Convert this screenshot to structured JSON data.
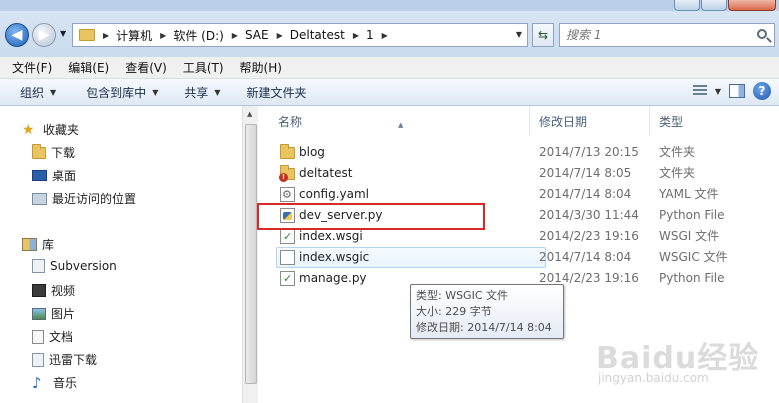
{
  "address": {
    "crumbs": [
      "计算机",
      "软件 (D:)",
      "SAE",
      "Deltatest",
      "1"
    ]
  },
  "search": {
    "placeholder": "搜索 1"
  },
  "menubar": [
    "文件(F)",
    "编辑(E)",
    "查看(V)",
    "工具(T)",
    "帮助(H)"
  ],
  "toolbar": {
    "organize": "组织",
    "include_library": "包含到库中",
    "share": "共享",
    "new_folder": "新建文件夹"
  },
  "nav": {
    "favorites": "收藏夹",
    "downloads": "下载",
    "desktop": "桌面",
    "recent": "最近访问的位置",
    "libraries": "库",
    "subversion": "Subversion",
    "videos": "视频",
    "pictures": "图片",
    "documents": "文档",
    "thunder": "迅雷下载",
    "music": "音乐"
  },
  "columns": {
    "name": "名称",
    "date": "修改日期",
    "type": "类型"
  },
  "files": [
    {
      "name": "blog",
      "date": "2014/7/13 20:15",
      "type": "文件夹",
      "icon": "folder-icon"
    },
    {
      "name": "deltatest",
      "date": "2014/7/14 8:05",
      "type": "文件夹",
      "icon": "folder-warning-icon"
    },
    {
      "name": "config.yaml",
      "date": "2014/7/14 8:04",
      "type": "YAML 文件",
      "icon": "config-file-icon"
    },
    {
      "name": "dev_server.py",
      "date": "2014/3/30 11:44",
      "type": "Python File",
      "icon": "python-file-icon"
    },
    {
      "name": "index.wsgi",
      "date": "2014/2/23 19:16",
      "type": "WSGI 文件",
      "icon": "wsgi-file-icon"
    },
    {
      "name": "index.wsgic",
      "date": "2014/7/14 8:04",
      "type": "WSGIC 文件",
      "icon": "blank-file-icon"
    },
    {
      "name": "manage.py",
      "date": "2014/2/23 19:16",
      "type": "Python File",
      "icon": "python-file-icon"
    }
  ],
  "tooltip": {
    "type": "类型: WSGIC 文件",
    "size": "大小: 229 字节",
    "modified": "修改日期: 2014/7/14 8:04"
  },
  "watermark": {
    "text": "Baidu经验",
    "sub": "jingyan.baidu.com"
  },
  "colors": {
    "highlight_box": "#d62a2a",
    "hover_row": "#e8f3fd",
    "folder": "#e9c460"
  }
}
